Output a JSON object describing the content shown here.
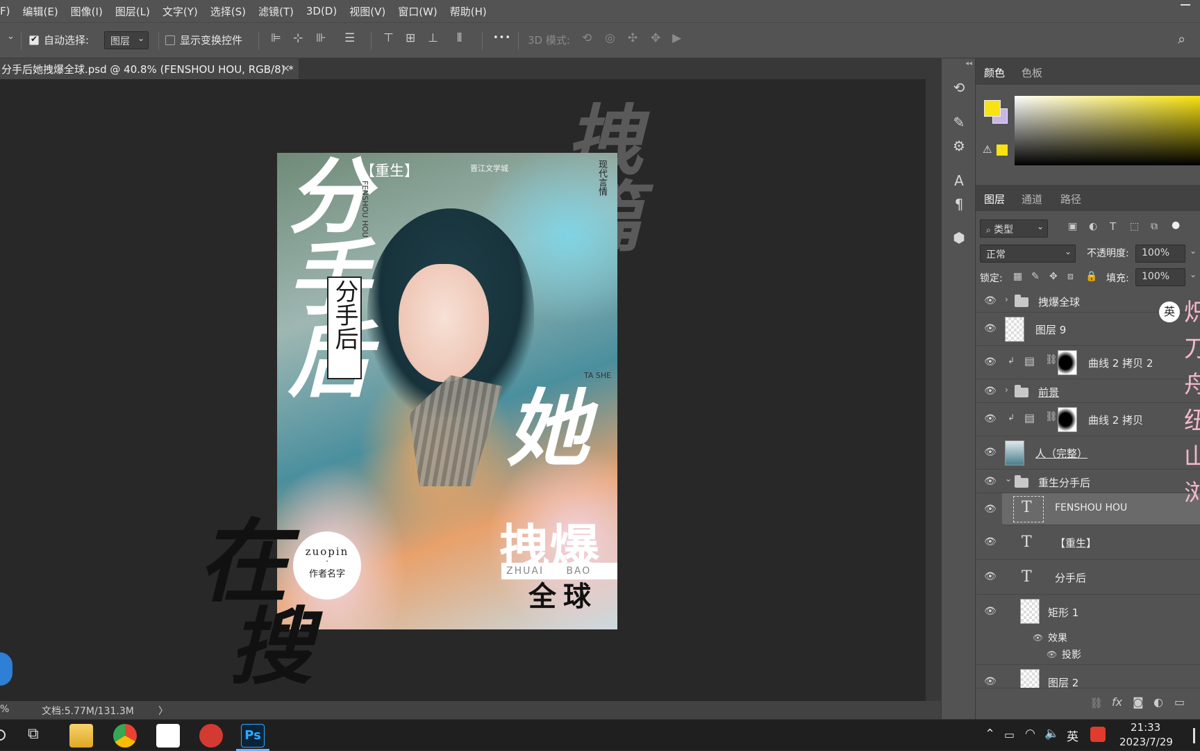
{
  "menu": {
    "items": [
      "F)",
      "编辑(E)",
      "图像(I)",
      "图层(L)",
      "文字(Y)",
      "选择(S)",
      "滤镜(T)",
      "3D(D)",
      "视图(V)",
      "窗口(W)",
      "帮助(H)"
    ]
  },
  "options": {
    "auto_select_label": "自动选择:",
    "auto_select_value": "图层",
    "show_transform_label": "显示变换控件",
    "mode_3d_label": "3D 模式:",
    "more_label": "•••"
  },
  "document": {
    "tab_title": "分手后她拽爆全球.psd @ 40.8% (FENSHOU HOU, RGB/8) *",
    "close_label": "×"
  },
  "poster": {
    "tag": "【重生】",
    "publisher": "晋江文学城",
    "vertical_box": "分手后",
    "pinyin_vertical": "FENSHOU HOU",
    "big_left": "分手后",
    "big_right": "她",
    "tashe": "TA SHE",
    "zhuai_bao": "拽爆",
    "zhuai_bao_pinyin": "ZHUAI     BAO",
    "quanqiu": "全球",
    "circle_top": "zuopin",
    "circle_mid": "·",
    "circle_bottom": "作者名字",
    "grey_brush": "拽篇",
    "dark_brush_top": "在",
    "dark_brush_bottom": "搜",
    "side_text": "现代言情"
  },
  "status": {
    "zoom": "%",
    "doc_size": "文档:5.77M/131.3M",
    "arrow": "〉"
  },
  "color_panel": {
    "tabs": [
      "颜色",
      "色板"
    ],
    "fg_color": "#f8e211",
    "bg_color": "#c8b6e6",
    "warning": "⚠"
  },
  "layers_panel": {
    "tabs": [
      "图层",
      "通道",
      "路径"
    ],
    "filter_label": "类型",
    "blend_mode": "正常",
    "opacity_label": "不透明度:",
    "opacity_value": "100%",
    "lock_label": "锁定:",
    "fill_label": "填充:",
    "fill_value": "100%",
    "layers": [
      {
        "name": "拽爆全球",
        "kind": "group-closed"
      },
      {
        "name": "图层 9",
        "kind": "pixel"
      },
      {
        "name": "曲线 2 拷贝 2",
        "kind": "adjustment"
      },
      {
        "name": "前景",
        "kind": "group-closed"
      },
      {
        "name": "曲线 2 拷贝",
        "kind": "adjustment"
      },
      {
        "name": "人（完整）",
        "kind": "image"
      },
      {
        "name": "重生分手后",
        "kind": "group-open"
      },
      {
        "name": "FENSHOU HOU",
        "kind": "text"
      },
      {
        "name": "【重生】",
        "kind": "text"
      },
      {
        "name": "分手后",
        "kind": "text"
      },
      {
        "name": "矩形 1",
        "kind": "shape"
      },
      {
        "name": "效果",
        "kind": "effects"
      },
      {
        "name": "投影",
        "kind": "effect"
      },
      {
        "name": "图层 2",
        "kind": "pixel"
      }
    ],
    "selected_layer": "FENSHOU HOU"
  },
  "overlay": {
    "ime_badge": "英",
    "pink_chars": [
      "炽",
      "刀",
      "舟",
      "纽",
      "山",
      "浏"
    ]
  },
  "taskbar": {
    "ime": "英",
    "time": "21:33",
    "date": "2023/7/29",
    "ps_label": "Ps"
  }
}
